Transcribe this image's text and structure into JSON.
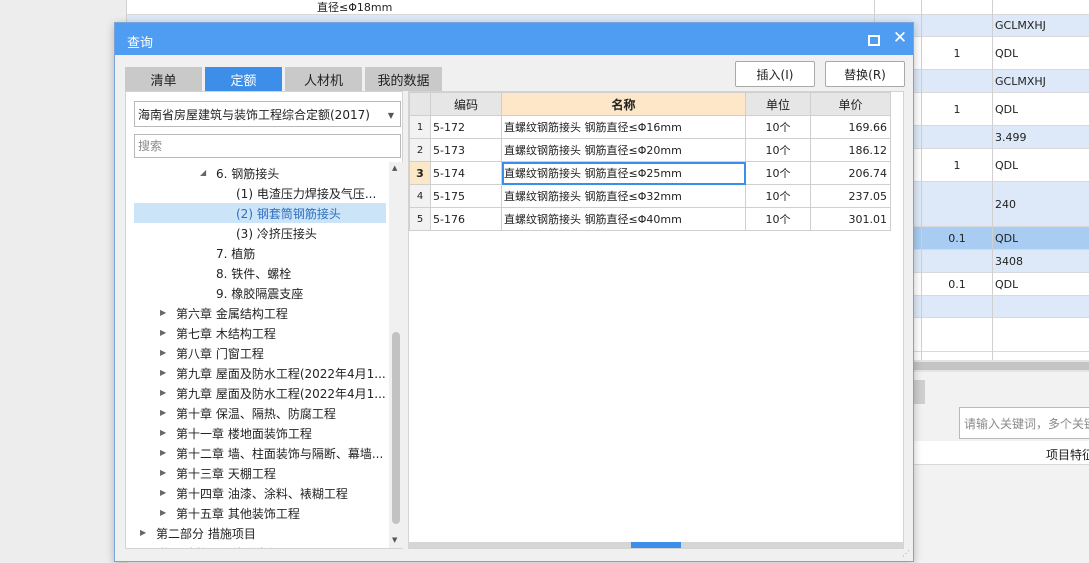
{
  "background": {
    "top_cut_text": "直径≤Φ18mm",
    "rows": [
      {
        "qty": "",
        "unit": "GCLMXHJ",
        "style": "blue"
      },
      {
        "qty": "1",
        "unit": "QDL",
        "style": "white"
      },
      {
        "qty": "",
        "unit": "GCLMXHJ",
        "style": "blue"
      },
      {
        "qty": "1",
        "unit": "QDL",
        "style": "white"
      },
      {
        "qty": "",
        "unit": "3.499",
        "style": "blue"
      },
      {
        "qty": "1",
        "unit": "QDL",
        "style": "white"
      },
      {
        "qty": "",
        "unit": "240",
        "style": "blue"
      },
      {
        "qty": "0.1",
        "unit": "QDL",
        "style": "hl"
      },
      {
        "qty": "",
        "unit": "3408",
        "style": "blue"
      },
      {
        "qty": "0.1",
        "unit": "QDL",
        "style": "white"
      },
      {
        "qty": "",
        "unit": "",
        "style": "blue"
      },
      {
        "qty": "",
        "unit": "",
        "style": "white"
      }
    ],
    "search_placeholder": "请输入关键词，多个关键",
    "feature_label": "项目特征"
  },
  "dialog": {
    "title": "查询",
    "tabs": [
      "清单",
      "定额",
      "人材机",
      "我的数据"
    ],
    "active_tab": 1,
    "insert_button": "插入(I)",
    "replace_button": "替换(R)",
    "quota_book": "海南省房屋建筑与装饰工程综合定额(2017)",
    "search_placeholder": "搜索",
    "tree": [
      {
        "label": "6. 钢筋接头",
        "level": 3,
        "toggle": "expanded"
      },
      {
        "label": "(1) 电渣压力焊接及气压...",
        "level": 4,
        "toggle": "none"
      },
      {
        "label": "(2) 钢套筒钢筋接头",
        "level": 4,
        "toggle": "none",
        "selected": true
      },
      {
        "label": "(3) 冷挤压接头",
        "level": 4,
        "toggle": "none"
      },
      {
        "label": "7. 植筋",
        "level": 3,
        "toggle": "none"
      },
      {
        "label": "8. 铁件、螺栓",
        "level": 3,
        "toggle": "none"
      },
      {
        "label": "9. 橡胶隔震支座",
        "level": 3,
        "toggle": "none"
      },
      {
        "label": "第六章 金属结构工程",
        "level": 2,
        "toggle": "collapsed"
      },
      {
        "label": "第七章 木结构工程",
        "level": 2,
        "toggle": "collapsed"
      },
      {
        "label": "第八章 门窗工程",
        "level": 2,
        "toggle": "collapsed"
      },
      {
        "label": "第九章 屋面及防水工程(2022年4月1...",
        "level": 2,
        "toggle": "collapsed"
      },
      {
        "label": "第九章 屋面及防水工程(2022年4月1...",
        "level": 2,
        "toggle": "collapsed"
      },
      {
        "label": "第十章 保温、隔热、防腐工程",
        "level": 2,
        "toggle": "collapsed"
      },
      {
        "label": "第十一章 楼地面装饰工程",
        "level": 2,
        "toggle": "collapsed"
      },
      {
        "label": "第十二章 墙、柱面装饰与隔断、幕墙...",
        "level": 2,
        "toggle": "collapsed"
      },
      {
        "label": "第十三章 天棚工程",
        "level": 2,
        "toggle": "collapsed"
      },
      {
        "label": "第十四章 油漆、涂料、裱糊工程",
        "level": 2,
        "toggle": "collapsed"
      },
      {
        "label": "第十五章 其他装饰工程",
        "level": 2,
        "toggle": "collapsed"
      },
      {
        "label": "第二部分 措施项目",
        "level": 1,
        "toggle": "collapsed"
      },
      {
        "label": "附录 建筑工程综合定额",
        "level": 1,
        "toggle": "collapsed"
      }
    ],
    "grid": {
      "headers": [
        "编码",
        "名称",
        "单位",
        "单价"
      ],
      "current_row": 3,
      "rows": [
        {
          "no": "1",
          "code": "5-172",
          "name": "直螺纹钢筋接头 钢筋直径≤Φ16mm",
          "unit": "10个",
          "price": "169.66"
        },
        {
          "no": "2",
          "code": "5-173",
          "name": "直螺纹钢筋接头 钢筋直径≤Φ20mm",
          "unit": "10个",
          "price": "186.12"
        },
        {
          "no": "3",
          "code": "5-174",
          "name": "直螺纹钢筋接头 钢筋直径≤Φ25mm",
          "unit": "10个",
          "price": "206.74"
        },
        {
          "no": "4",
          "code": "5-175",
          "name": "直螺纹钢筋接头 钢筋直径≤Φ32mm",
          "unit": "10个",
          "price": "237.05"
        },
        {
          "no": "5",
          "code": "5-176",
          "name": "直螺纹钢筋接头 钢筋直径≤Φ40mm",
          "unit": "10个",
          "price": "301.01"
        }
      ]
    }
  }
}
